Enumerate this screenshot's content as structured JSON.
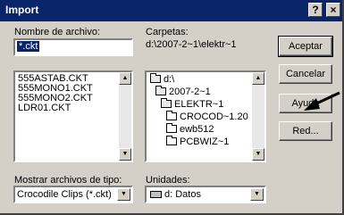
{
  "window": {
    "title": "Import"
  },
  "titlebar_buttons": {
    "help": "?",
    "close": "×"
  },
  "filename": {
    "label": "Nombre de archivo:",
    "value": "*.ckt",
    "files": [
      "555ASTAB.CKT",
      "555MONO1.CKT",
      "555MONO2.CKT",
      "LDR01.CKT"
    ]
  },
  "folders": {
    "label": "Carpetas:",
    "path": "d:\\2007-2~1\\elektr~1",
    "tree": [
      "d:\\",
      "2007-2~1",
      "ELEKTR~1",
      "CROCOD~1.20",
      "ewb512",
      "PCBWIZ~1"
    ]
  },
  "filetype": {
    "label": "Mostrar archivos de tipo:",
    "value": "Crocodile Clips (*.ckt)"
  },
  "drives": {
    "label": "Unidades:",
    "value": "d: Datos"
  },
  "buttons": {
    "accept": "Aceptar",
    "cancel": "Cancelar",
    "help": "Ayuda",
    "network": "Red..."
  },
  "icons": {
    "scroll_up": "▲",
    "scroll_down": "▼",
    "dropdown": "▼"
  }
}
